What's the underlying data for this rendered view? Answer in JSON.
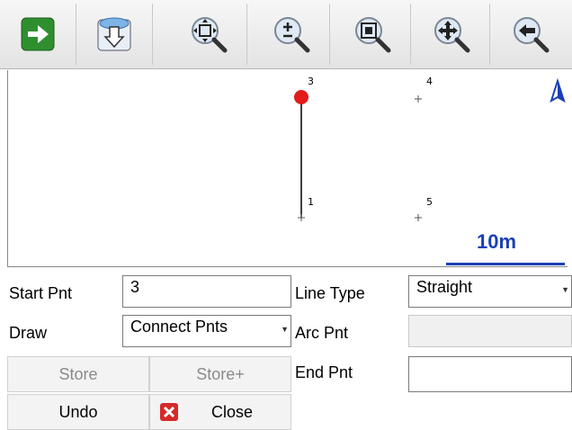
{
  "toolbar": {
    "buttons": [
      {
        "icon": "arrow-right-icon"
      },
      {
        "icon": "download-icon"
      },
      {
        "icon": "zoom-extents-icon"
      },
      {
        "icon": "zoom-in-out-icon"
      },
      {
        "icon": "zoom-window-icon"
      },
      {
        "icon": "pan-icon"
      },
      {
        "icon": "zoom-previous-icon"
      }
    ]
  },
  "map": {
    "points": [
      {
        "id": "3",
        "selected": true
      },
      {
        "id": "4",
        "selected": false
      },
      {
        "id": "1",
        "selected": false
      },
      {
        "id": "5",
        "selected": false
      }
    ],
    "scale_label": "10m",
    "north_color": "#1b3fb5",
    "selected_color": "#e31b1b"
  },
  "form": {
    "start_pnt_label": "Start Pnt",
    "start_pnt_value": "3",
    "line_type_label": "Line Type",
    "line_type_value": "Straight",
    "draw_label": "Draw",
    "draw_value": "Connect Pnts",
    "arc_pnt_label": "Arc Pnt",
    "arc_pnt_value": "",
    "end_pnt_label": "End Pnt",
    "end_pnt_value": ""
  },
  "buttons": {
    "store": "Store",
    "store_plus": "Store+",
    "undo": "Undo",
    "close": "Close"
  }
}
